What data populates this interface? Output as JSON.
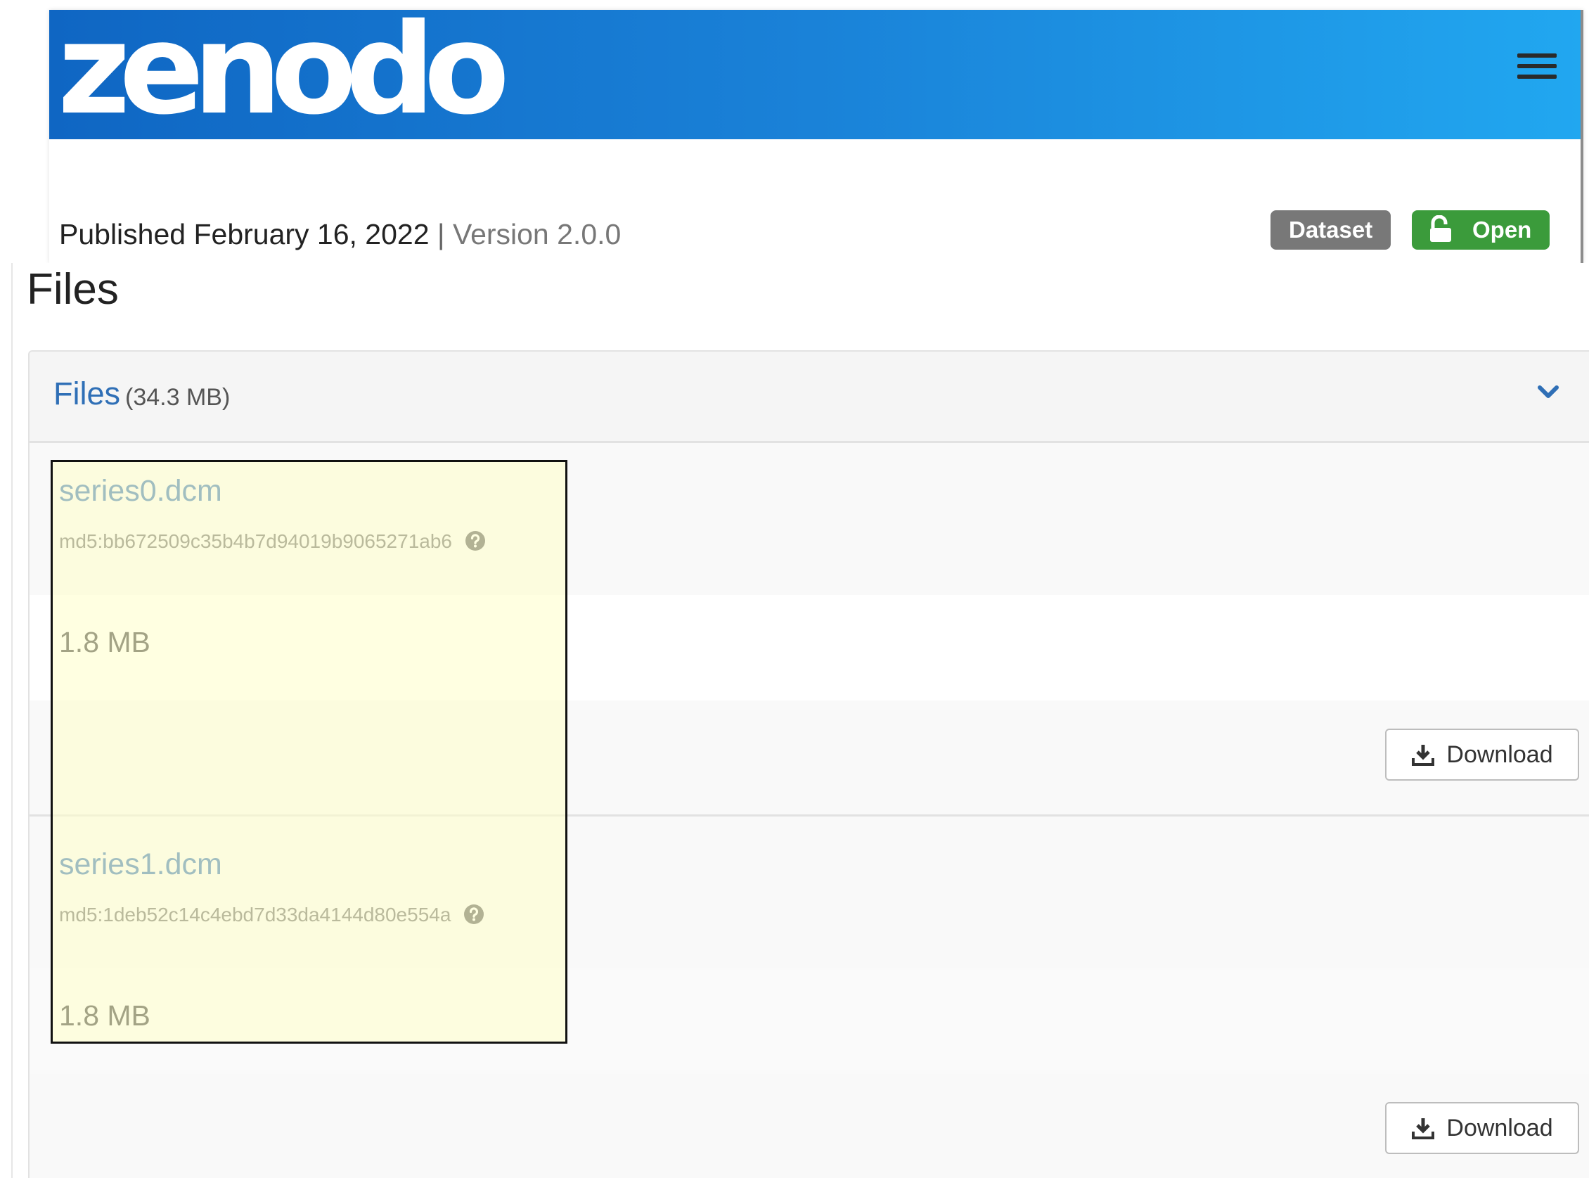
{
  "header": {
    "logo_text": "zenodo",
    "menu_icon": "hamburger-menu-icon"
  },
  "record": {
    "published_label": "Published February 16, 2022",
    "separator": "|",
    "version_label": "Version 2.0.0",
    "badges": {
      "dataset": "Dataset",
      "open": "Open"
    }
  },
  "files_section": {
    "title": "Files",
    "panel_title": "Files",
    "panel_size": "(34.3 MB)",
    "files": [
      {
        "name": "series0.dcm",
        "md5": "md5:bb672509c35b4b7d94019b9065271ab6",
        "size": "1.8 MB",
        "download_label": "Download"
      },
      {
        "name": "series1.dcm",
        "md5": "md5:1deb52c14c4ebd7d33da4144d80e554a",
        "size": "1.8 MB",
        "download_label": "Download"
      }
    ]
  },
  "colors": {
    "header_start": "#0f66c3",
    "header_end": "#21a7f0",
    "link": "#2f6fb6",
    "badge_dataset": "#787878",
    "badge_open": "#3b9b3b",
    "highlight": "#ffffc8"
  }
}
